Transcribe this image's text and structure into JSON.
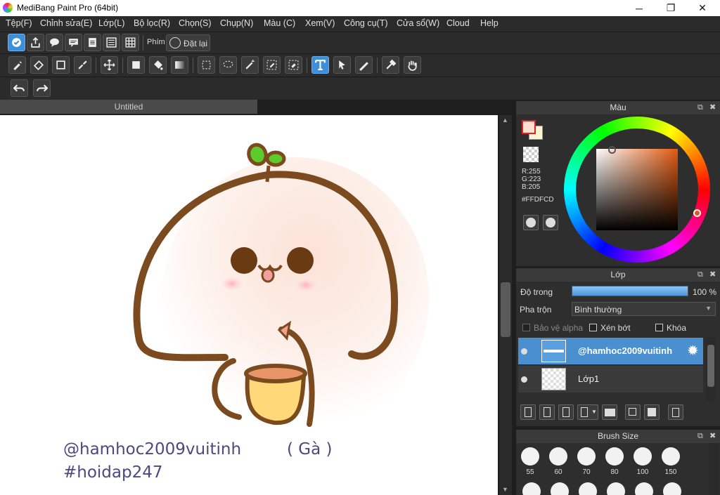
{
  "app": {
    "title": "MediBang Paint Pro (64bit)",
    "minimize": "─",
    "maximize": "❐",
    "close": "✕"
  },
  "menu": [
    "Tệp(F)",
    "Chỉnh sửa(E)",
    "Lớp(L)",
    "Bộ lọc(R)",
    "Chọn(S)",
    "Chụp(N)",
    "Màu (C)",
    "Xem(V)",
    "Công cụ(T)",
    "Cửa sổ(W)",
    "Cloud",
    "Help"
  ],
  "toolbar": {
    "shortcut_label": "Phím",
    "reset_label": "Đặt lại"
  },
  "document": {
    "tab_title": "Untitled",
    "watermark_user": "@hamhoc2009vuitinh",
    "watermark_name": "( Gà )",
    "watermark_tag": "#hoidap247"
  },
  "color_panel": {
    "title": "Màu",
    "r": "R:255",
    "g": "G:223",
    "b": "B:205",
    "hex": "#FFDFCD",
    "fg_color": "#ffdfcd",
    "bg_color": "#fff3d0"
  },
  "layer_panel": {
    "title": "Lớp",
    "opacity_label": "Độ trong",
    "opacity_value": "100 %",
    "opacity_fraction": 1.0,
    "blend_label": "Pha trộn",
    "blend_value": "Bình thường",
    "protect_alpha": "Bảo vệ alpha",
    "clipping": "Xén bớt",
    "lock": "Khóa",
    "layers": [
      {
        "name": "@hamhoc2009vuitinh",
        "selected": true
      },
      {
        "name": "Lớp1",
        "selected": false
      }
    ]
  },
  "brush_panel": {
    "title": "Brush Size",
    "sizes": [
      "55",
      "60",
      "70",
      "80",
      "100",
      "150"
    ]
  },
  "colors": {
    "accent": "#3d8fd8",
    "selected_layer": "#4a8fd0",
    "outline": "#7b4a1e"
  }
}
